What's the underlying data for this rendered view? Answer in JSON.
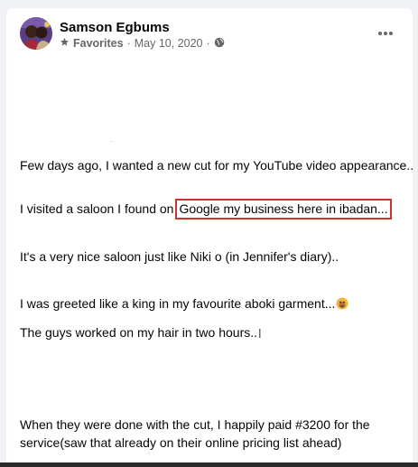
{
  "post": {
    "author": "Samson Egbums",
    "audience_label": "Favorites",
    "date": "May 10, 2020",
    "separator": "·",
    "paragraphs": {
      "p1": "Few days ago, I wanted a new cut for my YouTube video appearance..",
      "p2_prefix": "I visited a saloon I found on",
      "p2_highlight": "Google my business here in ibadan...",
      "p3": "It's a very nice saloon just like Niki o (in Jennifer's diary)..",
      "p4": "I was greeted like a king in my favourite aboki garment...",
      "p5": "The guys worked on my hair in two hours..",
      "p6": "When they were done with the cut, I happily paid #3200 for the service(saw that already on their online pricing list ahead)"
    }
  },
  "icons": {
    "audience": "star-icon",
    "privacy": "globe-icon",
    "more": "more-options-icon",
    "emoji_greeted": "emoji-face-icon",
    "emoji_worked": "emoji-icon"
  },
  "colors": {
    "highlight_border": "#d32f2f",
    "meta_text": "#65676b",
    "body_text": "#050505",
    "background": "#f0f2f5"
  }
}
